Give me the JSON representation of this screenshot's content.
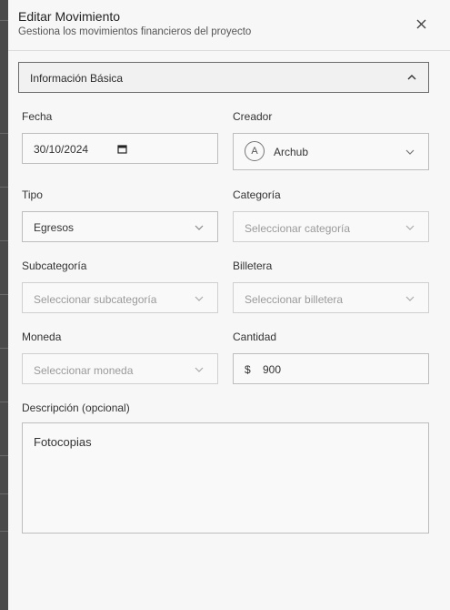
{
  "dialog": {
    "title": "Editar Movimiento",
    "subtitle": "Gestiona los movimientos financieros del proyecto"
  },
  "section": {
    "title": "Información Básica"
  },
  "form": {
    "fecha": {
      "label": "Fecha",
      "value": "30/10/2024"
    },
    "creador": {
      "label": "Creador",
      "avatar_initial": "A",
      "value": "Archub"
    },
    "tipo": {
      "label": "Tipo",
      "value": "Egresos"
    },
    "categoria": {
      "label": "Categoría",
      "placeholder": "Seleccionar categoría"
    },
    "subcategoria": {
      "label": "Subcategoría",
      "placeholder": "Seleccionar subcategoría"
    },
    "billetera": {
      "label": "Billetera",
      "placeholder": "Seleccionar billetera"
    },
    "moneda": {
      "label": "Moneda",
      "placeholder": "Seleccionar moneda"
    },
    "cantidad": {
      "label": "Cantidad",
      "symbol": "$",
      "value": "900"
    },
    "descripcion": {
      "label": "Descripción (opcional)",
      "value": "Fotocopias"
    }
  },
  "icons": {
    "close": "close-icon",
    "section_toggle": "chevron-up-icon",
    "dropdown": "chevron-down-icon",
    "calendar": "calendar-icon"
  }
}
